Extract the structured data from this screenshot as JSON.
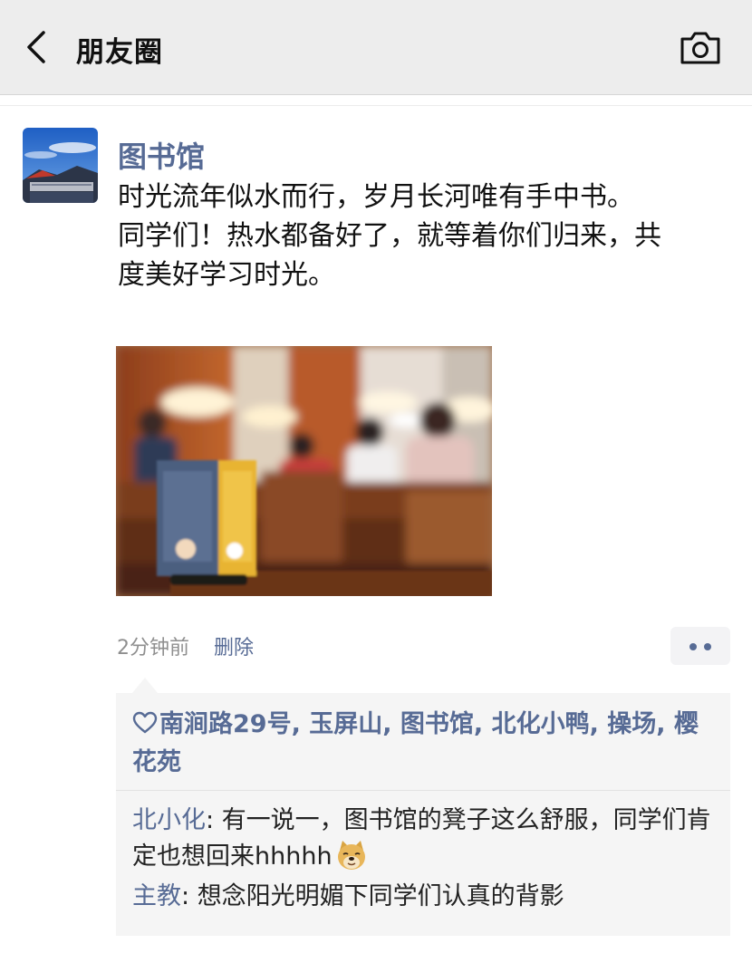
{
  "nav": {
    "title": "朋友圈",
    "back_icon": "chevron-left-icon",
    "camera_icon": "camera-icon"
  },
  "post": {
    "author": "图书馆",
    "text": [
      "时光流年似水而行，岁月长河唯有手中书。",
      "同学们！热水都备好了，就等着你们归来，共度美好学习时光。"
    ],
    "time": "2分钟前",
    "delete_label": "删除",
    "more_icon": "more-dots-icon"
  },
  "likes": {
    "icon": "heart-icon",
    "names": [
      "南涧路29号",
      "玉屏山",
      "图书馆",
      "北化小鸭",
      "操场",
      "樱花苑"
    ]
  },
  "comments": [
    {
      "author": "北小化",
      "sep": ": ",
      "text": "有一说一，图书馆的凳子这么舒服，同学们肯定也想回来hhhhh",
      "emoji": "doge-emoji-icon"
    },
    {
      "author": "主教",
      "sep": ": ",
      "text": "想念阳光明媚下同学们认真的背影"
    }
  ],
  "colors": {
    "link": "#576b95",
    "topbar": "#ededed",
    "comment_bg": "#f5f5f5",
    "meta_gray": "#8f8f8f"
  }
}
